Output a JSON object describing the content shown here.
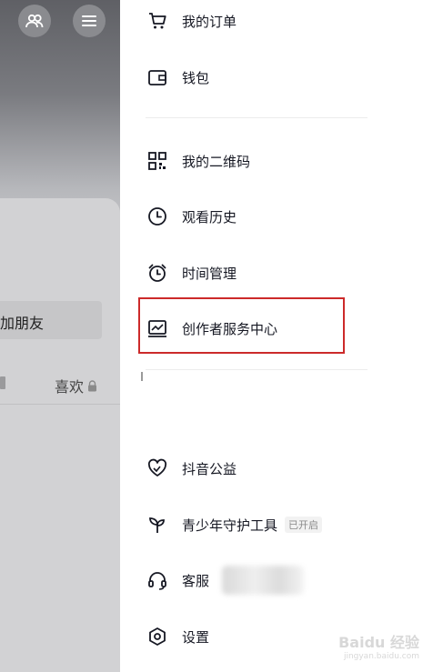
{
  "left_panel": {
    "add_friend": "加朋友",
    "likes_tab": "喜欢"
  },
  "menu": {
    "orders": "我的订单",
    "wallet": "钱包",
    "qrcode": "我的二维码",
    "history": "观看历史",
    "time_mgmt": "时间管理",
    "creator_center": "创作者服务中心",
    "charity": "抖音公益",
    "teen_tool": "青少年守护工具",
    "teen_tool_badge": "已开启",
    "customer_service": "客服",
    "settings": "设置"
  },
  "colors": {
    "highlight": "#cc2a2a"
  },
  "watermark": {
    "text": "Baidu 经验",
    "sub": "jingyan.baidu.com"
  }
}
